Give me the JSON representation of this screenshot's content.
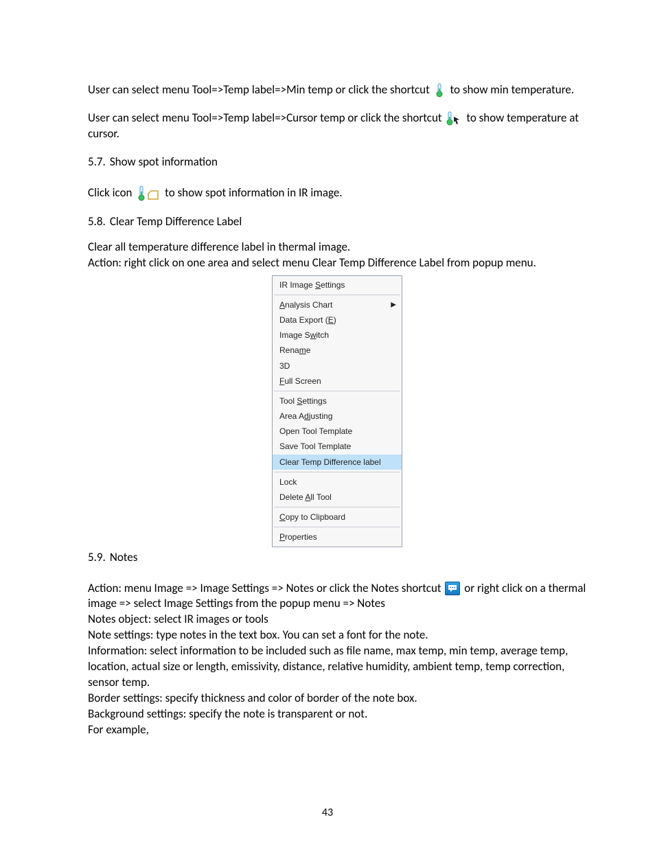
{
  "para1": {
    "prefix": "User can select menu Tool=>Temp label=>Min temp or click the shortcut ",
    "suffix": " to show min temperature."
  },
  "para2": {
    "prefix": "User can select menu Tool=>Temp label=>Cursor temp or click the shortcut ",
    "suffix": " to show temperature at cursor."
  },
  "sec57": {
    "num": "5.7.",
    "title": "Show spot information"
  },
  "sec57_line": {
    "prefix": "Click icon ",
    "suffix": " to show spot information in IR image."
  },
  "sec58": {
    "num": "5.8.",
    "title": "Clear Temp Difference Label"
  },
  "sec58_p1": "Clear all temperature difference label in thermal image.",
  "sec58_p2": "Action: right click on one area and select menu Clear Temp Difference Label from popup menu.",
  "menu": {
    "items": [
      {
        "pre": "IR Image ",
        "u": "S",
        "post": "ettings",
        "arrow": false
      },
      {
        "sep": true
      },
      {
        "pre": "",
        "u": "A",
        "post": "nalysis Chart",
        "arrow": true
      },
      {
        "pre": "Data Export (",
        "u": "E",
        "post": ")",
        "arrow": false
      },
      {
        "pre": "Image S",
        "u": "w",
        "post": "itch",
        "arrow": false
      },
      {
        "pre": "Rena",
        "u": "m",
        "post": "e",
        "arrow": false
      },
      {
        "pre": "3D",
        "u": "",
        "post": "",
        "arrow": false
      },
      {
        "pre": "",
        "u": "F",
        "post": "ull Screen",
        "arrow": false
      },
      {
        "sep": true
      },
      {
        "pre": "Tool ",
        "u": "S",
        "post": "ettings",
        "arrow": false
      },
      {
        "pre": "Area A",
        "u": "d",
        "post": "justing",
        "arrow": false
      },
      {
        "pre": "Open Tool  Template",
        "u": "",
        "post": "",
        "arrow": false
      },
      {
        "pre": "Save Tool  Template",
        "u": "",
        "post": "",
        "arrow": false
      },
      {
        "pre": "Clear Temp Difference label",
        "u": "",
        "post": "",
        "arrow": false,
        "highlight": true
      },
      {
        "sep": true
      },
      {
        "pre": "Lock",
        "u": "",
        "post": "",
        "arrow": false
      },
      {
        "pre": "Delete ",
        "u": "A",
        "post": "ll Tool",
        "arrow": false
      },
      {
        "sep": true
      },
      {
        "pre": "",
        "u": "C",
        "post": "opy to Clipboard",
        "arrow": false
      },
      {
        "sep": true
      },
      {
        "pre": "",
        "u": "P",
        "post": "roperties",
        "arrow": false
      }
    ]
  },
  "sec59": {
    "num": "5.9.",
    "title": "Notes"
  },
  "sec59_p1": {
    "prefix": "Action: menu Image => Image Settings => Notes or click the Notes shortcut ",
    "suffix": " or right click on a thermal image => select Image Settings from the popup menu => Notes"
  },
  "sec59_p2": "Notes object: select IR images or tools",
  "sec59_p3": "Note settings: type notes in the text box. You can set a font for the note.",
  "sec59_p4": "Information: select information to be included such as file name, max temp, min temp, average temp, location, actual size or length, emissivity, distance, relative humidity, ambient temp, temp correction, sensor temp.",
  "sec59_p5": "Border settings: specify thickness and color of border of the note box.",
  "sec59_p6": "Background settings: specify the note is transparent or not.",
  "sec59_p7": "For example,",
  "page_number": "43"
}
